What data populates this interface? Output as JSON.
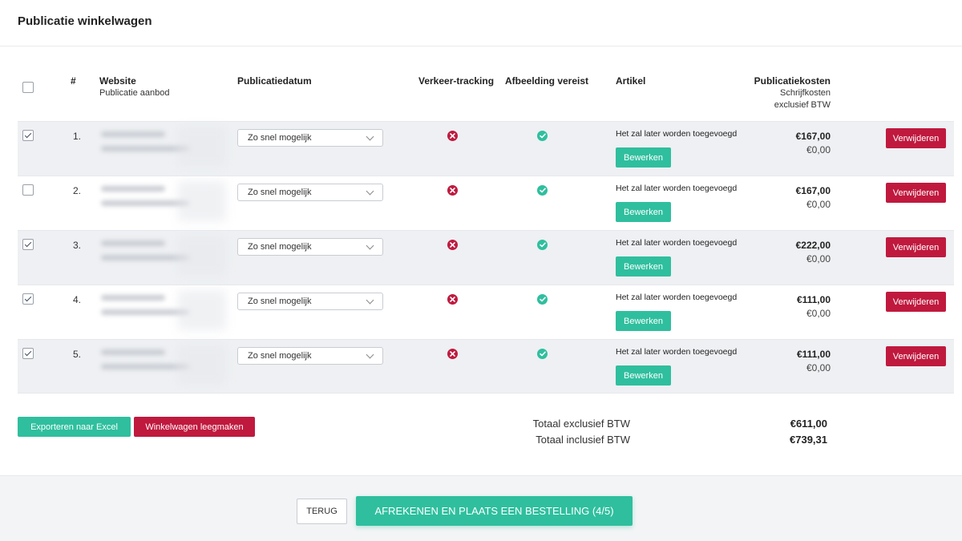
{
  "page": {
    "title": "Publicatie winkelwagen"
  },
  "table": {
    "headers": {
      "num": "#",
      "website": "Website",
      "website_sub": "Publicatie aanbod",
      "date": "Publicatiedatum",
      "tracking": "Verkeer-tracking",
      "image": "Afbeelding vereist",
      "article": "Artikel",
      "cost": "Publicatiekosten",
      "cost_sub1": "Schrijfkosten",
      "cost_sub2": "exclusief BTW"
    },
    "rows": [
      {
        "num": "1.",
        "checked": true,
        "date": "Zo snel mogelijk",
        "tracking": "x-circle-icon",
        "image": "check-circle-icon",
        "article": "Het zal later worden toegevoegd",
        "edit": "Bewerken",
        "price": "€167,00",
        "writing": "€0,00",
        "remove": "Verwijderen"
      },
      {
        "num": "2.",
        "checked": false,
        "date": "Zo snel mogelijk",
        "tracking": "x-circle-icon",
        "image": "check-circle-icon",
        "article": "Het zal later worden toegevoegd",
        "edit": "Bewerken",
        "price": "€167,00",
        "writing": "€0,00",
        "remove": "Verwijderen"
      },
      {
        "num": "3.",
        "checked": true,
        "date": "Zo snel mogelijk",
        "tracking": "x-circle-icon",
        "image": "check-circle-icon",
        "article": "Het zal later worden toegevoegd",
        "edit": "Bewerken",
        "price": "€222,00",
        "writing": "€0,00",
        "remove": "Verwijderen"
      },
      {
        "num": "4.",
        "checked": true,
        "date": "Zo snel mogelijk",
        "tracking": "x-circle-icon",
        "image": "check-circle-icon",
        "article": "Het zal later worden toegevoegd",
        "edit": "Bewerken",
        "price": "€111,00",
        "writing": "€0,00",
        "remove": "Verwijderen"
      },
      {
        "num": "5.",
        "checked": true,
        "date": "Zo snel mogelijk",
        "tracking": "x-circle-icon",
        "image": "check-circle-icon",
        "article": "Het zal later worden toegevoegd",
        "edit": "Bewerken",
        "price": "€111,00",
        "writing": "€0,00",
        "remove": "Verwijderen"
      }
    ]
  },
  "actions": {
    "export": "Exporteren naar Excel",
    "empty": "Winkelwagen leegmaken"
  },
  "totals": {
    "excl_label": "Totaal exclusief BTW",
    "excl_value": "€611,00",
    "incl_label": "Totaal inclusief BTW",
    "incl_value": "€739,31"
  },
  "footer": {
    "back": "TERUG",
    "checkout": "AFREKENEN EN PLAATS EEN BESTELLING (4/5)"
  },
  "colors": {
    "accent": "#2fbf9e",
    "danger": "#c0193e"
  }
}
